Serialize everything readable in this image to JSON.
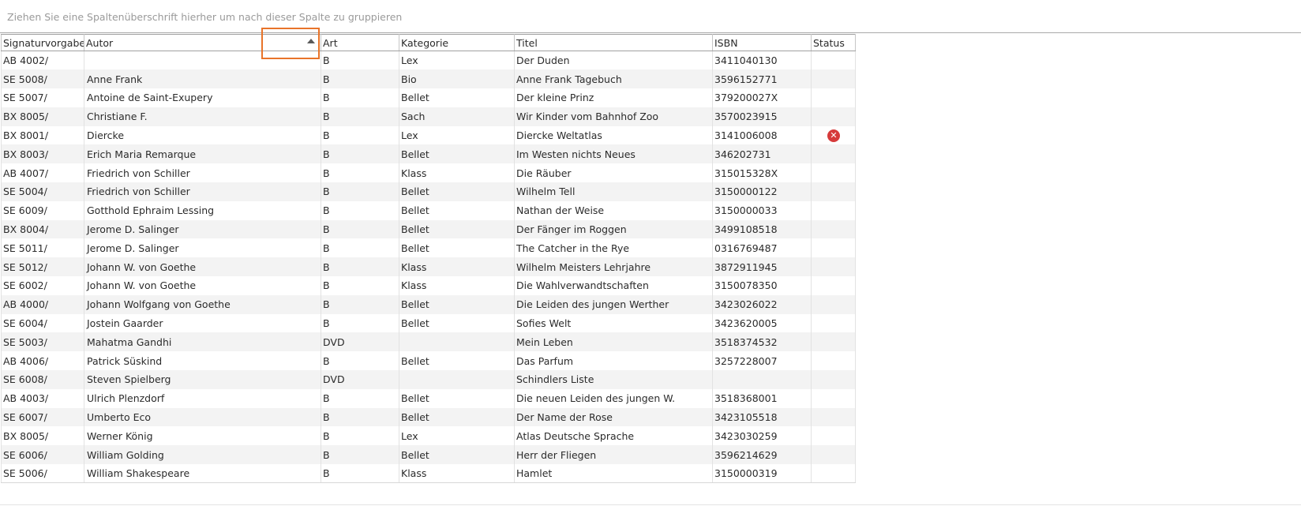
{
  "group_panel": {
    "hint": "Ziehen Sie eine Spaltenüberschrift hierher um nach dieser Spalte zu gruppieren"
  },
  "columns": [
    "Signaturvorgabe",
    "Autor",
    "Art",
    "Kategorie",
    "Titel",
    "ISBN",
    "Status"
  ],
  "sort": {
    "column": "Autor",
    "direction": "ascending"
  },
  "highlight_color": "#e8742a",
  "status_icon_color": "#d63a3a",
  "rows": [
    {
      "sig": "AB 4002/",
      "autor": "",
      "art": "B",
      "kategorie": "Lex",
      "titel": "Der Duden",
      "isbn": "3411040130",
      "status": ""
    },
    {
      "sig": "SE 5008/",
      "autor": "Anne Frank",
      "art": "B",
      "kategorie": "Bio",
      "titel": "Anne Frank Tagebuch",
      "isbn": "3596152771",
      "status": ""
    },
    {
      "sig": "SE 5007/",
      "autor": "Antoine de Saint-Exupery",
      "art": "B",
      "kategorie": "Bellet",
      "titel": "Der kleine Prinz",
      "isbn": "379200027X",
      "status": ""
    },
    {
      "sig": "BX 8005/",
      "autor": "Christiane F.",
      "art": "B",
      "kategorie": "Sach",
      "titel": "Wir Kinder vom Bahnhof Zoo",
      "isbn": "3570023915",
      "status": ""
    },
    {
      "sig": "BX 8001/",
      "autor": "Diercke",
      "art": "B",
      "kategorie": "Lex",
      "titel": "Diercke Weltatlas",
      "isbn": "3141006008",
      "status": "error-icon"
    },
    {
      "sig": "BX 8003/",
      "autor": "Erich Maria Remarque",
      "art": "B",
      "kategorie": "Bellet",
      "titel": "Im Westen nichts Neues",
      "isbn": "346202731",
      "status": ""
    },
    {
      "sig": "AB 4007/",
      "autor": "Friedrich von Schiller",
      "art": "B",
      "kategorie": "Klass",
      "titel": "Die Räuber",
      "isbn": "315015328X",
      "status": ""
    },
    {
      "sig": "SE 5004/",
      "autor": "Friedrich von Schiller",
      "art": "B",
      "kategorie": "Bellet",
      "titel": "Wilhelm Tell",
      "isbn": "3150000122",
      "status": ""
    },
    {
      "sig": "SE 6009/",
      "autor": "Gotthold Ephraim Lessing",
      "art": "B",
      "kategorie": "Bellet",
      "titel": "Nathan der Weise",
      "isbn": "3150000033",
      "status": ""
    },
    {
      "sig": "BX 8004/",
      "autor": "Jerome D. Salinger",
      "art": "B",
      "kategorie": "Bellet",
      "titel": "Der Fänger im Roggen",
      "isbn": "3499108518",
      "status": ""
    },
    {
      "sig": "SE 5011/",
      "autor": "Jerome D. Salinger",
      "art": "B",
      "kategorie": "Bellet",
      "titel": "The Catcher in the Rye",
      "isbn": "0316769487",
      "status": ""
    },
    {
      "sig": "SE 5012/",
      "autor": "Johann W. von Goethe",
      "art": "B",
      "kategorie": "Klass",
      "titel": "Wilhelm Meisters Lehrjahre",
      "isbn": "3872911945",
      "status": ""
    },
    {
      "sig": "SE 6002/",
      "autor": "Johann W. von Goethe",
      "art": "B",
      "kategorie": "Klass",
      "titel": "Die Wahlverwandtschaften",
      "isbn": "3150078350",
      "status": ""
    },
    {
      "sig": "AB 4000/",
      "autor": "Johann Wolfgang von Goethe",
      "art": "B",
      "kategorie": "Bellet",
      "titel": "Die Leiden des jungen Werther",
      "isbn": "3423026022",
      "status": ""
    },
    {
      "sig": "SE 6004/",
      "autor": "Jostein Gaarder",
      "art": "B",
      "kategorie": "Bellet",
      "titel": "Sofies Welt",
      "isbn": "3423620005",
      "status": ""
    },
    {
      "sig": "SE 5003/",
      "autor": "Mahatma Gandhi",
      "art": "DVD",
      "kategorie": "",
      "titel": "Mein Leben",
      "isbn": "3518374532",
      "status": ""
    },
    {
      "sig": "AB 4006/",
      "autor": "Patrick Süskind",
      "art": "B",
      "kategorie": "Bellet",
      "titel": "Das Parfum",
      "isbn": "3257228007",
      "status": ""
    },
    {
      "sig": "SE 6008/",
      "autor": "Steven Spielberg",
      "art": "DVD",
      "kategorie": "",
      "titel": "Schindlers Liste",
      "isbn": "",
      "status": ""
    },
    {
      "sig": "AB 4003/",
      "autor": "Ulrich Plenzdorf",
      "art": "B",
      "kategorie": "Bellet",
      "titel": "Die neuen Leiden des jungen W.",
      "isbn": "3518368001",
      "status": ""
    },
    {
      "sig": "SE 6007/",
      "autor": "Umberto Eco",
      "art": "B",
      "kategorie": "Bellet",
      "titel": "Der Name der Rose",
      "isbn": "3423105518",
      "status": ""
    },
    {
      "sig": "BX 8005/",
      "autor": "Werner König",
      "art": "B",
      "kategorie": "Lex",
      "titel": "Atlas Deutsche Sprache",
      "isbn": "3423030259",
      "status": ""
    },
    {
      "sig": "SE 6006/",
      "autor": "William Golding",
      "art": "B",
      "kategorie": "Bellet",
      "titel": "Herr der Fliegen",
      "isbn": "3596214629",
      "status": ""
    },
    {
      "sig": "SE 5006/",
      "autor": "William Shakespeare",
      "art": "B",
      "kategorie": "Klass",
      "titel": "Hamlet",
      "isbn": "3150000319",
      "status": ""
    }
  ]
}
